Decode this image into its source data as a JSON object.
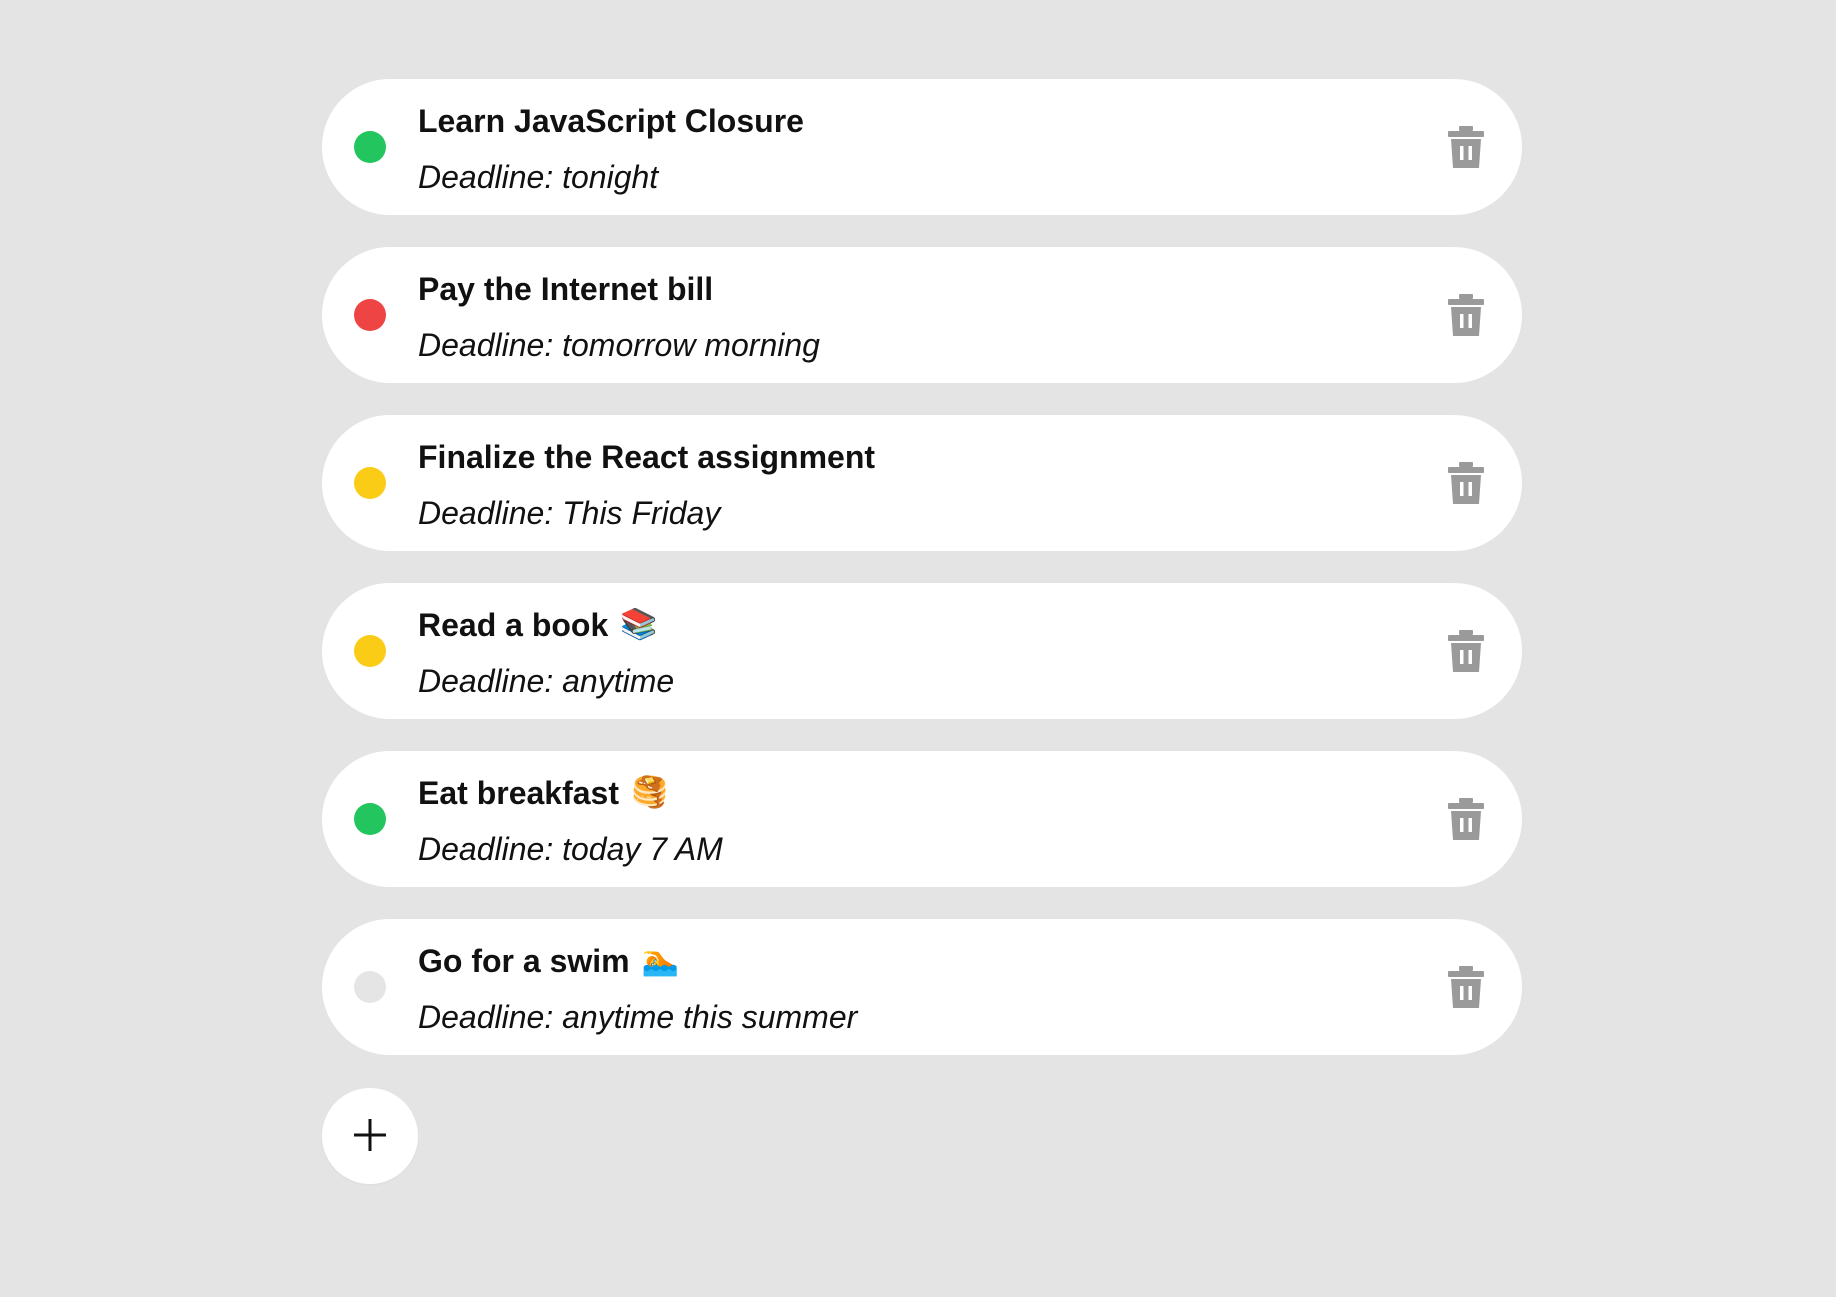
{
  "colors": {
    "background": "#e4e4e4",
    "card": "#ffffff",
    "text": "#111111",
    "trash_icon": "#9a9a9a",
    "status_green": "#22c55e",
    "status_red": "#ef4444",
    "status_yellow": "#facc15",
    "status_gray": "#e5e5e5"
  },
  "todos": [
    {
      "title": "Learn JavaScript Closure",
      "emoji": "",
      "deadline": "Deadline: tonight",
      "status_color": "#22c55e",
      "delete_icon": "trash-icon"
    },
    {
      "title": "Pay the Internet bill",
      "emoji": "",
      "deadline": "Deadline: tomorrow morning",
      "status_color": "#ef4444",
      "delete_icon": "trash-icon"
    },
    {
      "title": "Finalize the React assignment",
      "emoji": "",
      "deadline": "Deadline: This Friday",
      "status_color": "#facc15",
      "delete_icon": "trash-icon"
    },
    {
      "title": "Read a book",
      "emoji": "📚",
      "deadline": "Deadline: anytime",
      "status_color": "#facc15",
      "delete_icon": "trash-icon"
    },
    {
      "title": "Eat breakfast",
      "emoji": "🥞",
      "deadline": "Deadline: today 7 AM",
      "status_color": "#22c55e",
      "delete_icon": "trash-icon"
    },
    {
      "title": "Go for a swim",
      "emoji": "🏊",
      "deadline": "Deadline: anytime this summer",
      "status_color": "#e5e5e5",
      "delete_icon": "trash-icon"
    }
  ],
  "add_button": {
    "icon": "plus-icon"
  }
}
